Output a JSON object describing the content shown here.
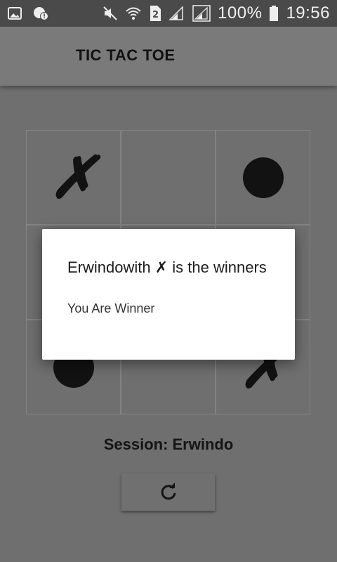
{
  "status_bar": {
    "battery": "100%",
    "time": "19:56",
    "sim_slot": "2",
    "icons": [
      "gallery-icon",
      "location-alert-icon",
      "mute-icon",
      "wifi-icon",
      "sim-2-icon",
      "signal-icon",
      "signal-icon",
      "battery-icon"
    ]
  },
  "app_bar": {
    "title": "TIC TAC TOE"
  },
  "board": {
    "cells": [
      "X",
      "",
      "O",
      "",
      "",
      "",
      "O",
      "",
      "X"
    ]
  },
  "session": {
    "label": "Session: Erwindo"
  },
  "reset": {
    "icon": "refresh-icon"
  },
  "dialog": {
    "title": "Erwindowith ✗ is the winners",
    "message": "You Are Winner"
  },
  "colors": {
    "background": "#6f6f6f",
    "appbar": "#7a7a7a",
    "statusbar": "#4a4a4a",
    "mark": "#121212",
    "dialog": "#ffffff"
  }
}
